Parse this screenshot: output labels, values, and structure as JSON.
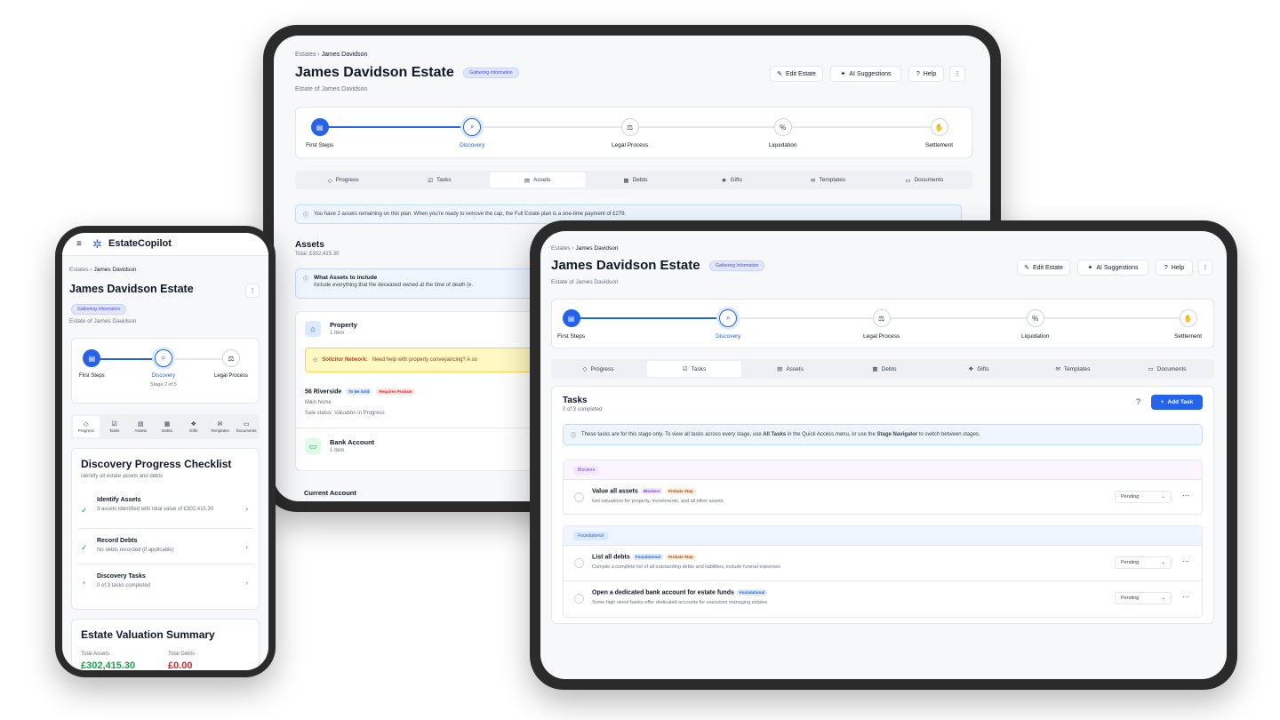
{
  "common": {
    "breadcrumb_root": "Estates",
    "breadcrumb_current": "James Davidson",
    "title": "James Davidson Estate",
    "status": "Gathering Information",
    "subtitle": "Estate of James Davidson",
    "edit_label": "Edit Estate",
    "ai_label": "AI Suggestions",
    "help_label": "Help",
    "steps": [
      "First Steps",
      "Discovery",
      "Legal Process",
      "Liquidation",
      "Settlement"
    ],
    "tabs": [
      "Progress",
      "Tasks",
      "Assets",
      "Debts",
      "Gifts",
      "Templates",
      "Documents"
    ]
  },
  "tablet_back": {
    "active_tab": "Assets",
    "cap_notice": "You have 2 assets remaining on this plan. When you're ready to remove the cap, the Full Estate plan is a one-time payment of £279.",
    "assets_title": "Assets",
    "assets_total": "Total: £302,415.30",
    "include_title": "What Assets to include",
    "include_text": "Include everything that the deceased owned at the time of death (e.",
    "property_title": "Property",
    "property_count": "1 item",
    "solicitor_label": "Solicitor Network:",
    "solicitor_text": "Need help with property conveyancing? A so",
    "riverside_name": "56 Riverside",
    "riverside_tag1": "To Be Sold",
    "riverside_tag2": "Requires Probate",
    "riverside_line1": "Main home",
    "riverside_line2": "Sale status: Valuation in Progress",
    "bank_title": "Bank Account",
    "bank_count": "1 item",
    "current_account": "Current Account"
  },
  "tablet_front": {
    "active_tab": "Tasks",
    "tasks_title": "Tasks",
    "tasks_count": "0 of 3 completed",
    "add_task": "Add Task",
    "notice_a": "These tasks are for this stage only. To view all tasks across every stage, use ",
    "notice_b": "All Tasks",
    "notice_c": " in the Quick Access menu, or use the ",
    "notice_d": "Stage Navigator",
    "notice_e": " to switch between stages.",
    "group1": "Blockers",
    "group2": "Foundational",
    "task1_name": "Value all assets",
    "task1_tag1": "Blockers",
    "task1_tag2": "Probate Step",
    "task1_desc": "Get valuations for property, investments, and all other assets",
    "task2_name": "List all debts",
    "task2_tag1": "Foundational",
    "task2_tag2": "Probate Step",
    "task2_desc": "Compile a complete list of all outstanding debts and liabilities, include funeral expenses",
    "task3_name": "Open a dedicated bank account for estate funds",
    "task3_tag1": "Foundational",
    "task3_desc": "Some high street banks offer dedicated accounts for executors managing estates",
    "status_value": "Pending"
  },
  "phone": {
    "brand": "EstateCopilot",
    "stage_text": "Stage 2 of 5",
    "tabs": [
      "Progress",
      "Tasks",
      "Assets",
      "Debts",
      "Gifts",
      "Templates",
      "Documents"
    ],
    "checklist_title": "Discovery Progress Checklist",
    "checklist_sub": "Identify all estate assets and debts",
    "item1_title": "Identify Assets",
    "item1_desc": "3 assets identified with total value of £302,415.30",
    "item2_title": "Record Debts",
    "item2_desc": "No debts recorded (if applicable)",
    "item3_title": "Discovery Tasks",
    "item3_desc": "0 of 3 tasks completed",
    "valuation_title": "Estate Valuation Summary",
    "total_assets_label": "Total Assets",
    "total_debts_label": "Total Debts",
    "total_assets_value": "£302,415.30",
    "total_debts_value": "£0.00"
  },
  "colors": {
    "accent": "#2563eb",
    "green": "#16a34a",
    "orange": "#ea580c",
    "red": "#dc2626",
    "bezel": "#2b2b2b"
  }
}
